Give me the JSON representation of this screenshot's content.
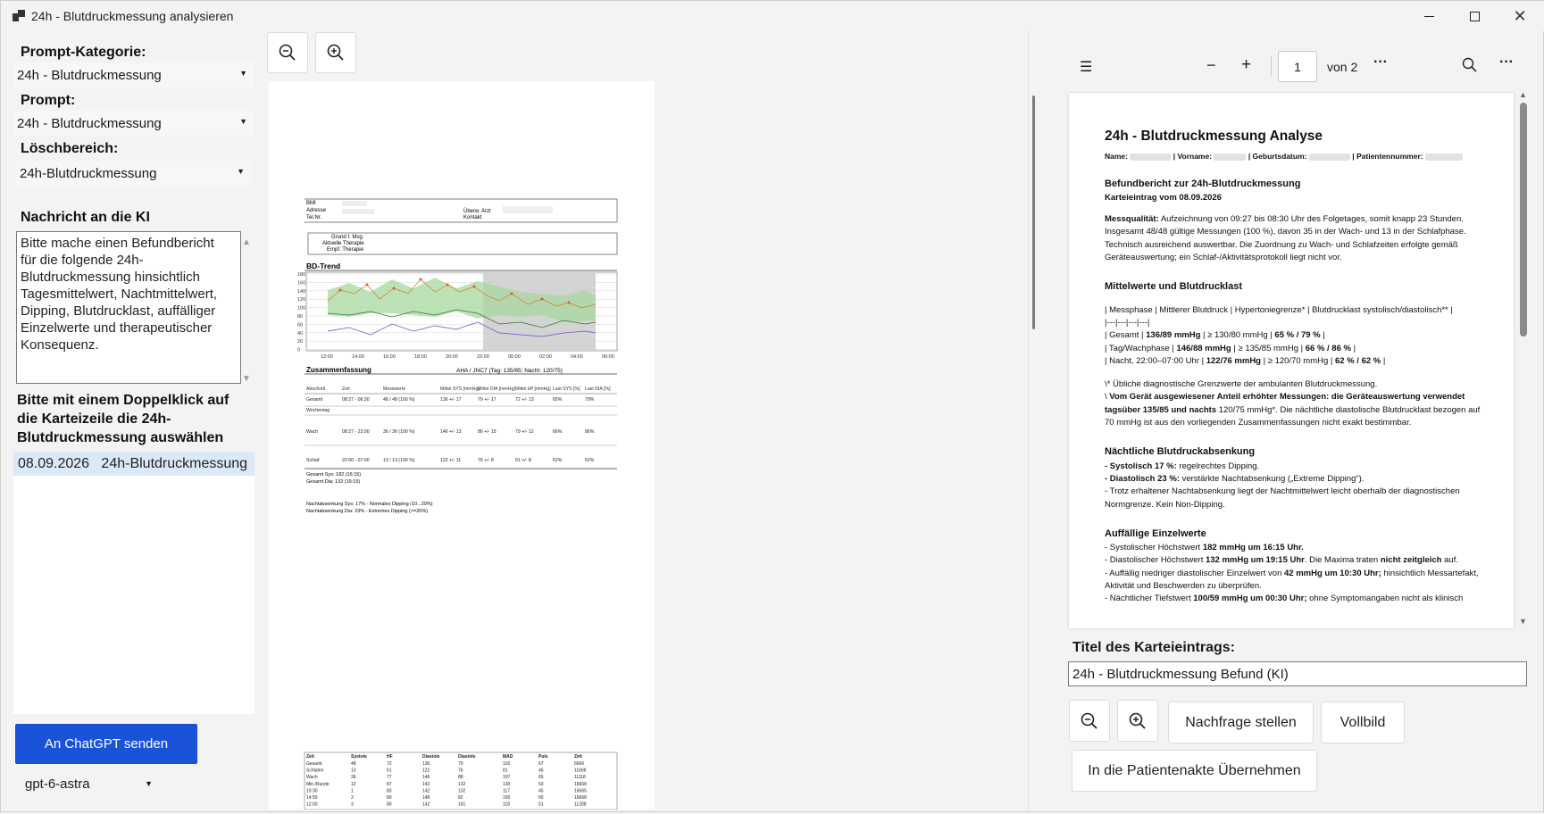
{
  "window": {
    "title": "24h - Blutdruckmessung analysieren"
  },
  "left": {
    "category_label": "Prompt-Kategorie:",
    "category_value": "24h - Blutdruckmessung",
    "prompt_label": "Prompt:",
    "prompt_value": "24h - Blutdruckmessung",
    "delete_label": "Löschbereich:",
    "delete_value": "24h-Blutdruckmessung",
    "message_label": "Nachricht an die KI",
    "message_text": "Bitte mache einen Befundbericht für die folgende 24h-Blutdruckmessung hinsichtlich Tagesmittelwert, Nachtmittelwert, Dipping, Blutdrucklast, auffälliger Einzelwerte und therapeutischer Konsequenz.",
    "pick_hint": "Bitte mit einem Doppelklick auf die Karteizeile die 24h-Blutdruckmessung auswählen",
    "list_date": "08.09.2026",
    "list_title": "24h-Blutdruckmessung",
    "send_label": "An ChatGPT senden",
    "model_value": "gpt-6-astra"
  },
  "pdf": {
    "page_number": "1",
    "page_total": "von 2",
    "heading": "24h - Blutdruckmessung Analyse",
    "name_line": {
      "name": "Name:",
      "vorname": "| Vorname:",
      "geb": "| Geburtsdatum:",
      "pat": "| Patientennummer:"
    },
    "s1_title": "Befundbericht zur 24h-Blutdruckmessung",
    "s1_sub": "Karteieintrag vom 08.09.2026",
    "mq_label": "Messqualität:",
    "mq_text": " Aufzeichnung von 09:27 bis 08:30 Uhr des Folgetages, somit knapp 23 Stunden. Insgesamt 48/48 gültige Messungen (100 %), davon 35 in der Wach- und 13 in der Schlafphase. Technisch ausreichend auswertbar. Die Zuordnung zu Wach- und Schlafzeiten erfolgte gemäß Geräteauswertung; ein Schlaf-/Aktivitätsprotokoll liegt nicht vor.",
    "s2_title": "Mittelwerte und Blutdrucklast",
    "table_header": "| Messphase | Mittlerer Blutdruck | Hypertoniegrenze* | Blutdrucklast systolisch/diastolisch** |",
    "table_sep": "|---|---|---|---|",
    "row1a": "| Gesamt | ",
    "row1b": "136/89 mmHg",
    "row1c": " | ≥ 130/80 mmHg | ",
    "row1d": "65 % / 79 %",
    "row1e": " |",
    "row2a": "| Tag/Wachphase | ",
    "row2b": "146/88 mmHg",
    "row2c": " | ≥ 135/85 mmHg | ",
    "row2d": "66 % / 86 %",
    "row2e": " |",
    "row3a": "| Nacht, 22:00–07:00 Uhr | ",
    "row3b": "122/76 mmHg",
    "row3c": " | ≥ 120/70 mmHg | ",
    "row3d": "62 % / 62 %",
    "row3e": " |",
    "fn1": "\\* Übliche diagnostische Grenzwerte der ambulanten Blutdruckmessung.",
    "fn2a": "\\ ",
    "fn2b": "Vom Gerät ausgewiesener Anteil erhöhter Messungen: die Geräteauswertung verwendet tagsüber 135/85 und nachts",
    "fn2c": " 120/75 mmHg*. Die nächtliche diastolische Blutdrucklast bezogen auf 70 mmHg ist aus den vorliegenden Zusammenfassungen nicht exakt bestimmbar.",
    "s3_title": "Nächtliche Blutdruckabsenkung",
    "d1a": "- Systolisch 17 %:",
    "d1b": " regelrechtes Dipping.",
    "d2a": "- Diastolisch 23 %:",
    "d2b": " verstärkte Nachtabsenkung („Extreme Dipping“).",
    "d3": "- Trotz erhaltener Nachtabsenkung liegt der Nachtmittelwert leicht oberhalb der diagnostischen Normgrenze. Kein Non-Dipping.",
    "s4_title": "Auffällige Einzelwerte",
    "e1a": "- Systolischer Höchstwert ",
    "e1b": "182 mmHg um 16:15 Uhr.",
    "e2a": "- Diastolischer Höchstwert ",
    "e2b": "132 mmHg um 19:15 Uhr",
    "e2c": ". Die Maxima traten ",
    "e2d": "nicht zeitgleich",
    "e2e": " auf.",
    "e3a": "- Auffällig niedriger diastolischer Einzelwert von ",
    "e3b": "42 mmHg um 10:30 Uhr;",
    "e3c": " hinsichtlich Messartefakt, Aktivität und Beschwerden zu überprüfen.",
    "e4a": "- Nächtlicher Tiefstwert ",
    "e4b": "100/59 mmHg um 00:30 Uhr;",
    "e4c": " ohne Symptomangaben nicht als klinisch"
  },
  "entry": {
    "title_label": "Titel des Karteieintrags:",
    "title_value": "24h - Blutdruckmessung  Befund (KI)",
    "ask_label": "Nachfrage stellen",
    "full_label": "Vollbild",
    "adopt_label": "In die Patientenakte Übernehmen"
  },
  "doc": {
    "bmi": "BMI",
    "adresse": "Adresse",
    "tel": "Tel.Nr.",
    "arzt": "Überw. Arzt",
    "kontakt": "Kontakt",
    "grund": "Grund f. Msg.",
    "therapie": "Aktuelle Therapie",
    "empf": "Empf. Therapie",
    "trend": "BD-Trend",
    "y_ticks": [
      "180",
      "160",
      "140",
      "120",
      "100",
      "80",
      "60",
      "40",
      "20",
      "0"
    ],
    "x_ticks": [
      "12:00",
      "14:00",
      "16:00",
      "18:00",
      "20:00",
      "22:00",
      "00:00",
      "02:00",
      "04:00",
      "06:00"
    ],
    "sum_title": "Zusammenfassung",
    "sum_std": "AHA / JNC7 (Tag: 135/85; Nacht: 120/75)",
    "cols": [
      "Abschnitt",
      "Zeit",
      "Messwerte",
      "Mittel SYS [mmHg]",
      "Mittel DIA [mmHg]",
      "Mittel bP [mmHg]",
      "Last SYS [%]",
      "Last DIA [%]"
    ],
    "r_gesamt": [
      "Gesamt",
      "08:27 - 06:30",
      "48 / 48 (100 %)",
      "136 +/- 17",
      "79 +/- 17",
      "72 +/- 13",
      "65%",
      "79%"
    ],
    "r_wochen": "Wochentag",
    "r_wach": [
      "Wach",
      "08:27 - 22:00",
      "36 / 36 (100 %)",
      "146 +/- 13",
      "86 +/- 15",
      "79 +/- 12",
      "66%",
      "86%"
    ],
    "r_schlaf": [
      "Schlaf",
      "22:00 - 07:00",
      "13 / 13 (100 %)",
      "122 +/- 11",
      "76 +/- 8",
      "61 +/- 8",
      "62%",
      "62%"
    ],
    "ges_sys": "Gesamt Sys: 182 (16:15)",
    "ges_dia": "Gesamt Dia: 132 (19:15)",
    "nacht_sys": "Nachtabsenkung Sys: 17% - Normales Dipping (10...20%)",
    "nacht_dia": "Nachtabsenkung Dia: 23% - Extremes Dipping (>=20%)",
    "t2_head": [
      "Zeit",
      "Systole",
      "HF",
      "Diastole",
      "Diastole",
      "MAD",
      "Puls",
      "Zeit"
    ],
    "t2_rows": [
      [
        "Gesamt",
        "48",
        "72",
        "136",
        "79",
        "102",
        "67",
        "6666"
      ],
      [
        "Schlafen",
        "13",
        "61",
        "122",
        "76",
        "81",
        "46",
        "11666"
      ],
      [
        "Wach",
        "36",
        "77",
        "146",
        "88",
        "107",
        "65",
        "11118"
      ],
      [
        "Min./Runde",
        "12",
        "87",
        "142",
        "132",
        "130",
        "53",
        "16668"
      ],
      [
        "10:30",
        "1",
        "83",
        "142",
        "132",
        "117",
        "45",
        "16665"
      ],
      [
        "14:59",
        "3",
        "80",
        "148",
        "82",
        "150",
        "65",
        "16668"
      ],
      [
        "12:00",
        "3",
        "80",
        "142",
        "161",
        "118",
        "51",
        "11288"
      ]
    ]
  }
}
